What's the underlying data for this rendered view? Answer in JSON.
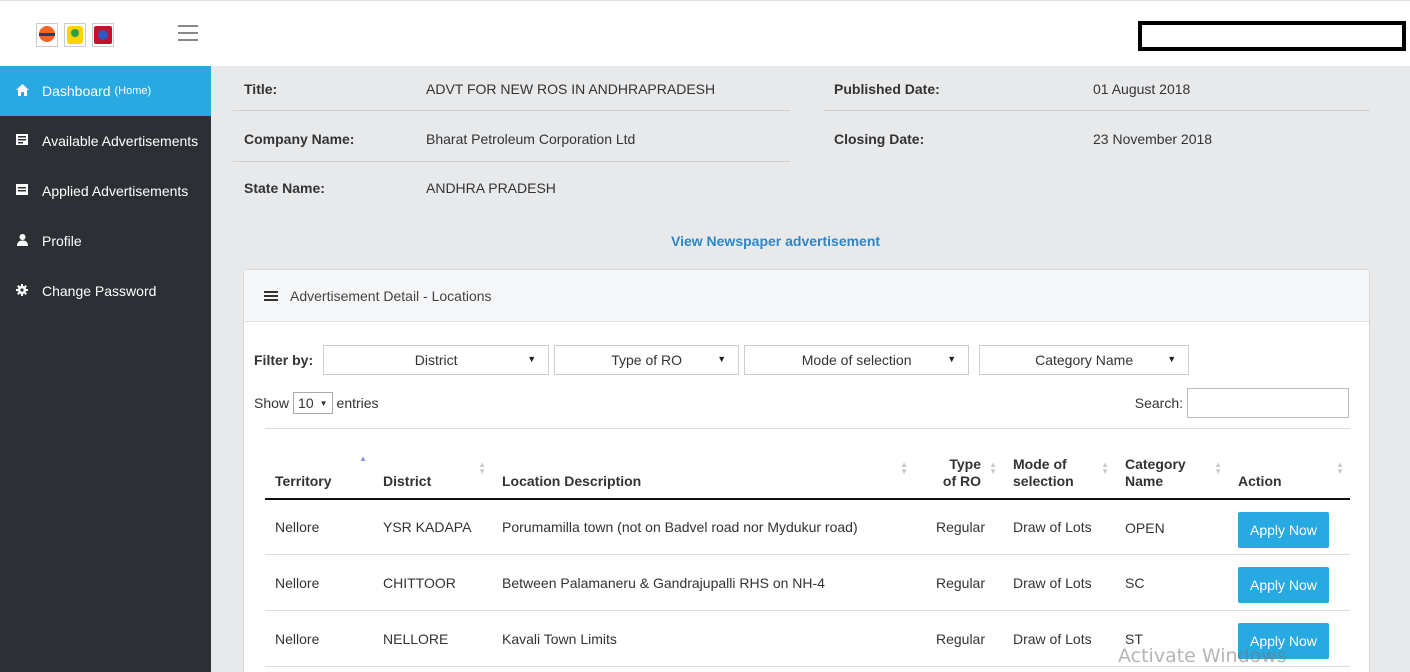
{
  "sidebar": {
    "items": [
      {
        "label": "Dashboard",
        "sub": "(Home)",
        "icon": "home-icon"
      },
      {
        "label": "Available Advertisements",
        "icon": "newspaper-icon"
      },
      {
        "label": "Applied Advertisements",
        "icon": "list-icon"
      },
      {
        "label": "Profile",
        "icon": "user-icon"
      },
      {
        "label": "Change Password",
        "icon": "gear-icon"
      }
    ]
  },
  "advert": {
    "title_label": "Title:",
    "title_value": "ADVT FOR NEW ROS IN ANDHRAPRADESH",
    "published_label": "Published Date:",
    "published_value": "01 August 2018",
    "company_label": "Company Name:",
    "company_value": "Bharat Petroleum Corporation Ltd",
    "closing_label": "Closing Date:",
    "closing_value": "23 November 2018",
    "state_label": "State Name:",
    "state_value": "ANDHRA PRADESH",
    "view_link": "View Newspaper advertisement"
  },
  "panel": {
    "heading": "Advertisement Detail - Locations",
    "filter_label": "Filter by:",
    "filters": [
      "District",
      "Type of RO",
      "Mode of selection",
      "Category Name"
    ],
    "show_label": "Show",
    "entries_value": "10",
    "entries_label": "entries",
    "search_label": "Search:"
  },
  "table": {
    "headers": [
      "Territory",
      "District",
      "Location Description",
      "Type of RO",
      "Mode of selection",
      "Category Name",
      "Action"
    ],
    "rows": [
      {
        "territory": "Nellore",
        "district": "YSR KADAPA",
        "location": "Porumamilla town (not on Badvel road nor Mydukur road)",
        "type": "Regular",
        "mode": "Draw of Lots",
        "category": "OPEN",
        "action": "Apply Now"
      },
      {
        "territory": "Nellore",
        "district": "CHITTOOR",
        "location": "Between Palamaneru & Gandrajupalli RHS on NH-4",
        "type": "Regular",
        "mode": "Draw of Lots",
        "category": "SC",
        "action": "Apply Now"
      },
      {
        "territory": "Nellore",
        "district": "NELLORE",
        "location": "Kavali Town Limits",
        "type": "Regular",
        "mode": "Draw of Lots",
        "category": "ST",
        "action": "Apply Now"
      }
    ]
  },
  "watermark": "Activate Windows",
  "colors": {
    "accent": "#27a9e1",
    "sidebar": "#2c3035",
    "link": "#2a87c8"
  }
}
